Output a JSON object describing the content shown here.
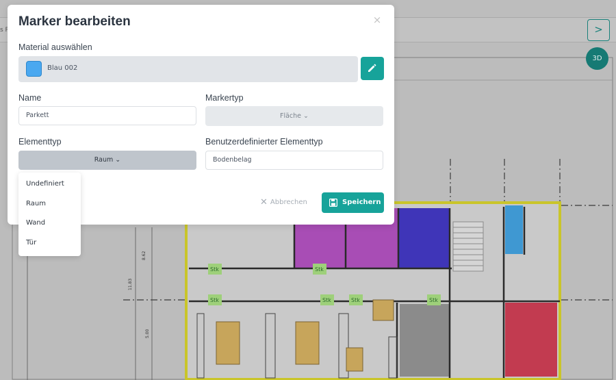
{
  "background": {
    "breadcrumb_fragment": "s R",
    "next_button_icon": "chevron-right-icon",
    "next_button_label": ">",
    "view_3d_label": "3D",
    "plan_labels": {
      "stk": "Stk",
      "dim_a": "8.62",
      "dim_b": "11.83",
      "dim_c": "5.00"
    }
  },
  "modal": {
    "title": "Marker bearbeiten",
    "close_icon": "close-icon",
    "close_label": "×",
    "material": {
      "label": "Material auswählen",
      "value": "Blau 002",
      "swatch_color": "#4aa8f0",
      "edit_icon": "pencil-icon"
    },
    "name": {
      "label": "Name",
      "value": "Parkett"
    },
    "markertyp": {
      "label": "Markertyp",
      "value": "Fläche ⌄"
    },
    "elementtyp": {
      "label": "Elementtyp",
      "value": "Raum ⌄",
      "options": [
        "Undefiniert",
        "Raum",
        "Wand",
        "Tür"
      ]
    },
    "custom_elementtyp": {
      "label": "Benutzerdefinierter Elementtyp",
      "value": "Bodenbelag"
    },
    "cancel_label": "Abbrechen",
    "save_label": "Speichern",
    "accent_color": "#17a39a"
  }
}
